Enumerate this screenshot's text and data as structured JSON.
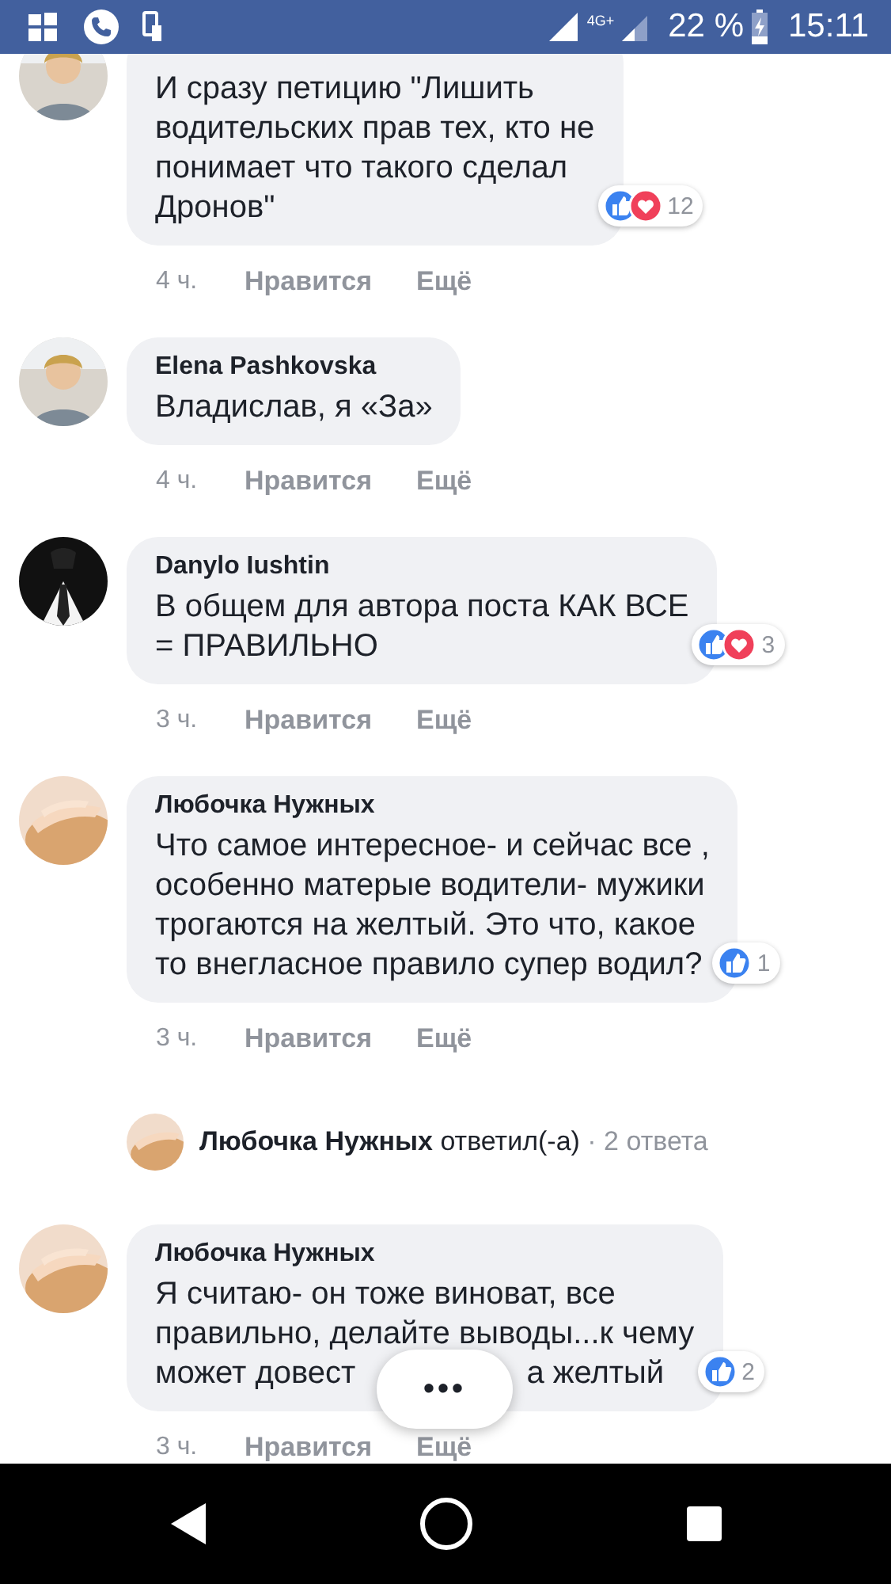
{
  "status_bar": {
    "network": "4G+",
    "battery": "22 %",
    "time": "15:11"
  },
  "comments": [
    {
      "lines": [
        "И сразу петицию \"Лишить",
        "водительских прав тех, кто не",
        "понимает что такого сделал",
        "Дронов\""
      ],
      "reactions": [
        {
          "kind": "like"
        },
        {
          "kind": "love"
        }
      ],
      "reaction_count": "12",
      "time": "4 ч.",
      "like_action": "Нравится",
      "more_action": "Ещё"
    },
    {
      "author": "Elena Pashkovska",
      "lines": [
        "Владислав, я «За»"
      ],
      "time": "4 ч.",
      "like_action": "Нравится",
      "more_action": "Ещё"
    },
    {
      "author": "Danylo Iushtin",
      "lines": [
        "В общем для автора поста КАК ВСЕ",
        "= ПРАВИЛЬНО"
      ],
      "reactions": [
        {
          "kind": "like"
        },
        {
          "kind": "love"
        }
      ],
      "reaction_count": "3",
      "time": "3 ч.",
      "like_action": "Нравится",
      "more_action": "Ещё"
    },
    {
      "author": "Любочка Нужных",
      "lines": [
        "Что самое интересное- и сейчас все ,",
        "особенно матерые водители- мужики",
        "трогаются на желтый. Это что, какое",
        "то внегласное правило супер водил?"
      ],
      "reactions": [
        {
          "kind": "like"
        }
      ],
      "reaction_count": "1",
      "time": "3 ч.",
      "like_action": "Нравится",
      "more_action": "Ещё",
      "replies": {
        "author": "Любочка Нужных",
        "verb": "ответил(-а)",
        "count": "· 2 ответа"
      }
    },
    {
      "author": "Любочка Нужных",
      "lines": [
        "Я считаю- он тоже виноват, все",
        "правильно, делайте выводы...к чему"
      ],
      "covered_line": [
        "может довест",
        "а желтый"
      ],
      "reactions": [
        {
          "kind": "like"
        }
      ],
      "reaction_count": "2",
      "time": "3 ч.",
      "like_action": "Нравится",
      "more_action": "Ещё"
    }
  ],
  "more_button": "•••"
}
